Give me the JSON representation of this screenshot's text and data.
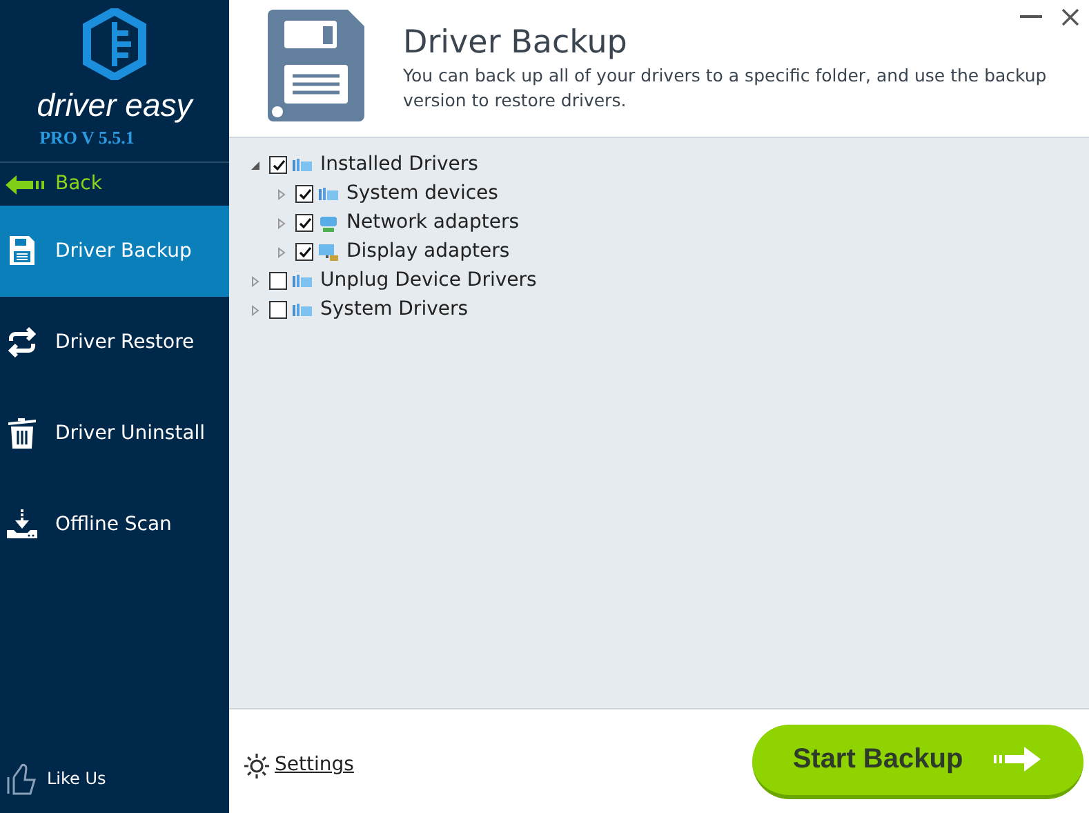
{
  "brand": {
    "name": "driver easy",
    "version": "PRO V 5.5.1"
  },
  "back": {
    "label": "Back"
  },
  "nav": [
    {
      "kind": "backup",
      "label": "Driver Backup",
      "selected": true
    },
    {
      "kind": "restore",
      "label": "Driver Restore",
      "selected": false
    },
    {
      "kind": "uninstall",
      "label": "Driver Uninstall",
      "selected": false
    },
    {
      "kind": "offline",
      "label": "Offline Scan",
      "selected": false
    }
  ],
  "like": {
    "label": "Like Us"
  },
  "header": {
    "title": "Driver Backup",
    "description": "You can back up all of your drivers to a specific folder, and use the backup version to restore drivers."
  },
  "tree": [
    {
      "label": "Installed Drivers",
      "kind": "folder",
      "checked": true,
      "expanded": true,
      "children": [
        {
          "label": "System devices",
          "kind": "folder",
          "checked": true,
          "expanded": false
        },
        {
          "label": "Network adapters",
          "kind": "network",
          "checked": true,
          "expanded": false
        },
        {
          "label": "Display adapters",
          "kind": "display",
          "checked": true,
          "expanded": false
        }
      ]
    },
    {
      "label": "Unplug Device Drivers",
      "kind": "folder",
      "checked": false,
      "expanded": false
    },
    {
      "label": "System Drivers",
      "kind": "folder",
      "checked": false,
      "expanded": false
    }
  ],
  "footer": {
    "settings": "Settings",
    "start_button": "Start Backup"
  }
}
